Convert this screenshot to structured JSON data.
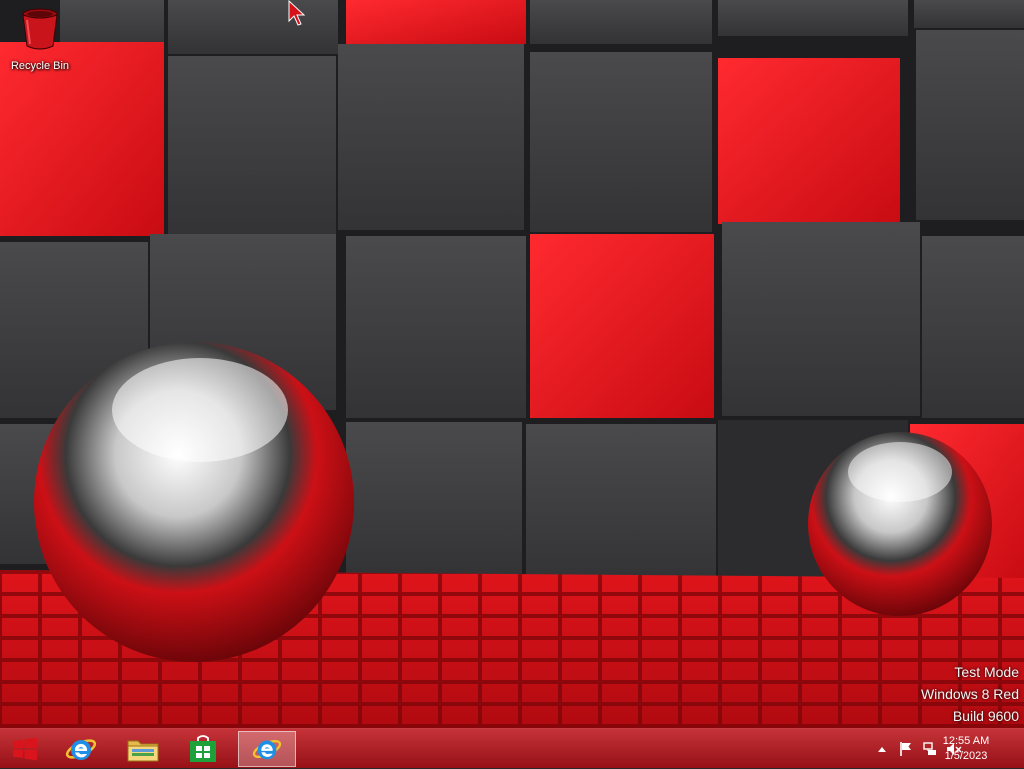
{
  "desktop": {
    "icons": [
      {
        "label": "Recycle Bin",
        "icon": "recycle-bin-icon"
      }
    ]
  },
  "watermark": {
    "line1": "Test Mode",
    "line2": "Windows 8 Red",
    "line3": "Build 9600"
  },
  "taskbar": {
    "pinned": [
      {
        "name": "internet-explorer",
        "icon": "ie-icon"
      },
      {
        "name": "file-explorer",
        "icon": "folder-icon"
      },
      {
        "name": "store",
        "icon": "store-icon"
      },
      {
        "name": "internet-explorer-running",
        "icon": "ie-icon",
        "active": true
      }
    ],
    "tray": {
      "icons": [
        "show-hidden-icons-chevron",
        "action-center-flag-icon",
        "network-icon",
        "volume-muted-icon"
      ],
      "time": "12:55 AM",
      "date": "1/5/2023"
    }
  },
  "theme": {
    "taskbar_color": "#b01e24",
    "accent_red": "#e8121a",
    "cube_gray": "#3d3d3f"
  }
}
